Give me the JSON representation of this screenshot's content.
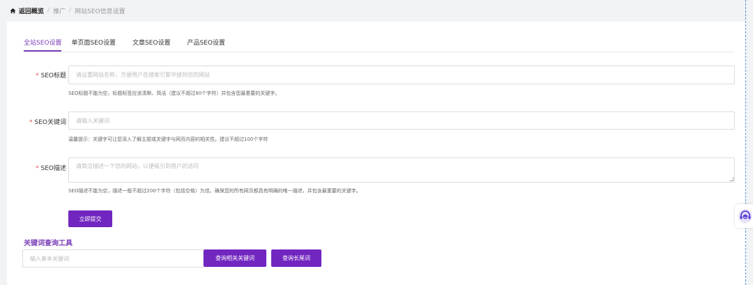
{
  "breadcrumb": {
    "home": "返回概览",
    "sep": "/",
    "level1": "推广",
    "level2": "网站SEO信息设置"
  },
  "tabs": [
    "全站SEO设置",
    "单页面SEO设置",
    "文章SEO设置",
    "产品SEO设置"
  ],
  "form": {
    "required_mark": "*",
    "title": {
      "label": "SEO标题",
      "placeholder": "请设置网站名称，方便用户在搜索引擎中搜到您的网站",
      "hint": "SEO标题不能为空，标题标签应该清晰、简洁（建议不超过80个字符）并包含您最重要的关键字。"
    },
    "keywords": {
      "label": "SEO关键词",
      "placeholder": "请输入关键词",
      "hint": "温馨提示：关键字可让您深入了解主题或关键字与网页内容的相关性。建议不超过100个字符"
    },
    "description": {
      "label": "SEO描述",
      "placeholder": "请简洁描述一下您的网站，以便吸引到用户的访问",
      "hint": "SEO描述不能为空，描述一般不超过200个字符（包括空格）为佳。确保您的所有网页都具有明确的唯一描述，并包含最重要的关键字。"
    },
    "submit": "立即提交"
  },
  "tool": {
    "title": "关键词查询工具",
    "placeholder": "输入基本关键词",
    "related_btn": "查询相关关键词",
    "longtail_btn": "查询长尾词"
  },
  "colors": {
    "accent": "#7226c0",
    "required": "#e5484d"
  }
}
